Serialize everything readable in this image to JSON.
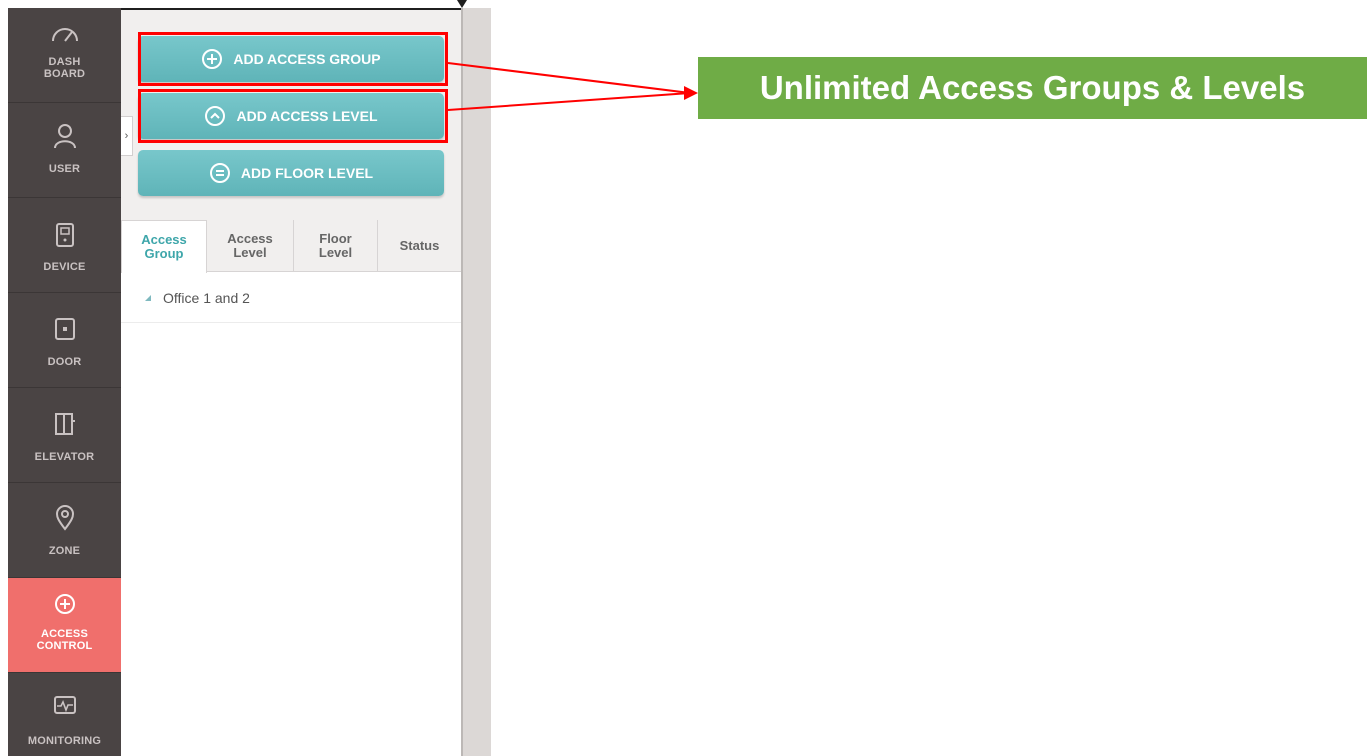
{
  "nav": {
    "items": [
      {
        "label_line1": "DASH",
        "label_line2": "BOARD",
        "icon": "gauge-icon"
      },
      {
        "label_line1": "USER",
        "label_line2": "",
        "icon": "user-icon"
      },
      {
        "label_line1": "DEVICE",
        "label_line2": "",
        "icon": "device-icon"
      },
      {
        "label_line1": "DOOR",
        "label_line2": "",
        "icon": "door-icon"
      },
      {
        "label_line1": "ELEVATOR",
        "label_line2": "",
        "icon": "elevator-icon"
      },
      {
        "label_line1": "ZONE",
        "label_line2": "",
        "icon": "location-pin-icon"
      },
      {
        "label_line1": "ACCESS",
        "label_line2": "CONTROL",
        "icon": "shield-plus-icon",
        "active": true
      },
      {
        "label_line1": "MONITORING",
        "label_line2": "",
        "icon": "monitor-icon"
      }
    ]
  },
  "toolbar": {
    "add_access_group": "ADD ACCESS GROUP",
    "add_access_level": "ADD ACCESS LEVEL",
    "add_floor_level": "ADD FLOOR LEVEL"
  },
  "tabs": [
    {
      "line1": "Access",
      "line2": "Group",
      "active": true
    },
    {
      "line1": "Access",
      "line2": "Level"
    },
    {
      "line1": "Floor",
      "line2": "Level"
    },
    {
      "line1": "Status",
      "line2": ""
    }
  ],
  "tree": {
    "items": [
      {
        "label": "Office 1 and 2"
      }
    ]
  },
  "callout": {
    "text": "Unlimited Access Groups & Levels"
  },
  "colors": {
    "nav_bg": "#4a4444",
    "nav_active": "#f06f6c",
    "button_teal": "#6abdc1",
    "tab_active_text": "#3ea6aa",
    "highlight_red": "#ff0000",
    "callout_green": "#6fac46"
  }
}
